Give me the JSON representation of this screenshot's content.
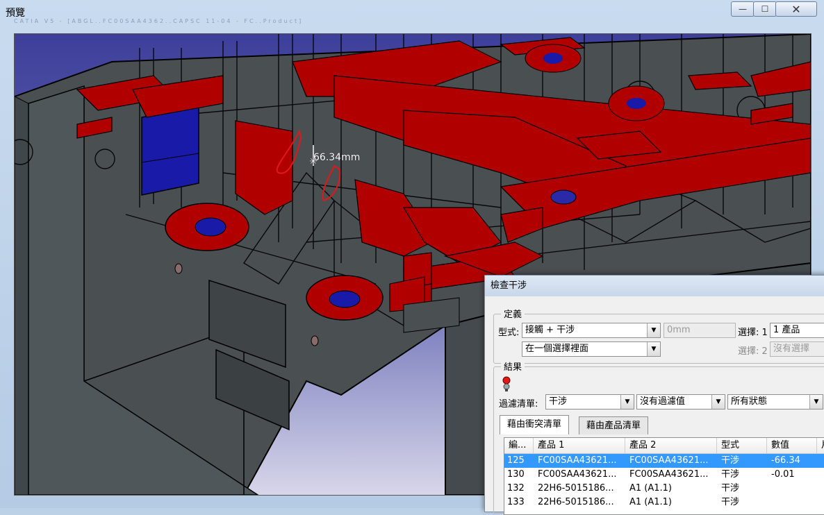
{
  "window": {
    "title": "預覽",
    "ghost_caption": "CATIA V5 - [ABGL..FC00SAA4362..CAPSC 11-04 - FC..Product]",
    "buttons": {
      "minimize": "—",
      "maximize": "☐",
      "close": "✕"
    }
  },
  "viewport": {
    "measurement": "66.34mm"
  },
  "dialog": {
    "title": "檢查干涉",
    "definition": {
      "group_label": "定義",
      "type_label": "型式:",
      "type_value": "接觸 + 干涉",
      "clearance_value": "0mm",
      "scope_value": "在一個選擇裡面",
      "selection1_label": "選擇: 1",
      "selection1_value": "1 產品",
      "selection2_label": "選擇: 2",
      "selection2_value": "沒有選擇"
    },
    "results": {
      "group_label": "結果",
      "filter_label": "過濾清單:",
      "filter_type": "干涉",
      "filter_value": "沒有過濾值",
      "filter_status": "所有狀態",
      "tabs": [
        "藉由衝突清單",
        "藉由產品清單"
      ],
      "columns": [
        "編...",
        "產品 1",
        "產品 2",
        "型式",
        "數值",
        "片"
      ],
      "rows": [
        {
          "no": "125",
          "product1": "FC00SAA43621...",
          "product2": "FC00SAA43621...",
          "type": "干涉",
          "value": "-66.34",
          "selected": true
        },
        {
          "no": "130",
          "product1": "FC00SAA43621...",
          "product2": "FC00SAA43621...",
          "type": "干涉",
          "value": "-0.01",
          "selected": false
        },
        {
          "no": "132",
          "product1": "22H6-5015186...",
          "product2": "A1 (A1.1)",
          "type": "干涉",
          "value": "",
          "selected": false
        },
        {
          "no": "133",
          "product1": "22H6-5015186...",
          "product2": "A1 (A1.1)",
          "type": "干涉",
          "value": "",
          "selected": false
        }
      ]
    }
  },
  "colors": {
    "model_body": "#4a4f52",
    "clash_red": "#b00000",
    "selection_blue": "#1a1aa8",
    "row_highlight": "#3399ff"
  }
}
